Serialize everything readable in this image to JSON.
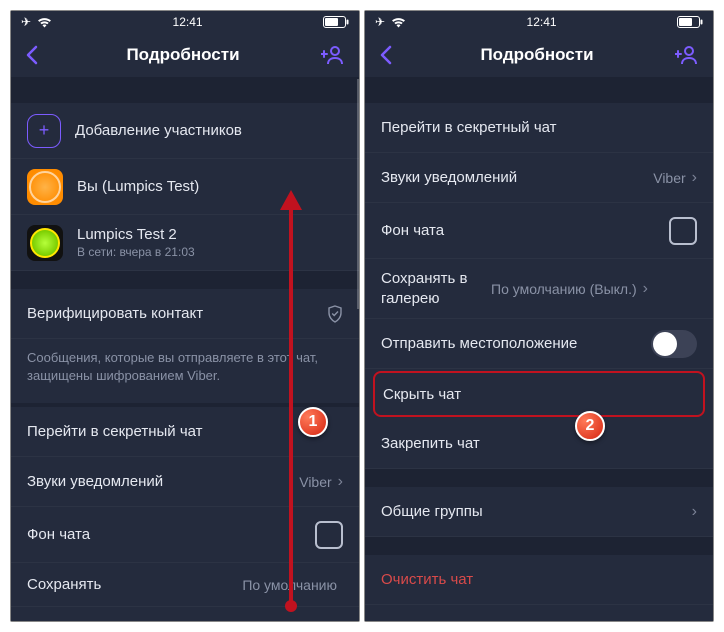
{
  "status": {
    "time": "12:41"
  },
  "nav": {
    "title": "Подробности"
  },
  "left": {
    "add_participants": "Добавление участников",
    "you": "Вы (Lumpics Test)",
    "contact2_name": "Lumpics Test 2",
    "contact2_sub": "В сети: вчера в 21:03",
    "verify": "Верифицировать контакт",
    "note": "Сообщения, которые вы отправляете в этот чат, защищены шифрованием Viber.",
    "secret": "Перейти в секретный чат",
    "sounds": "Звуки уведомлений",
    "sounds_value": "Viber",
    "background": "Фон чата",
    "save_gallery": "Сохранять",
    "save_gallery_value": "По умолчанию"
  },
  "right": {
    "secret": "Перейти в секретный чат",
    "sounds": "Звуки уведомлений",
    "sounds_value": "Viber",
    "background": "Фон чата",
    "save_gallery": "Сохранять в галерею",
    "save_gallery_value": "По умолчанию (Выкл.)",
    "send_location": "Отправить местоположение",
    "hide_chat": "Скрыть чат",
    "pin_chat": "Закрепить чат",
    "groups": "Общие группы",
    "clear": "Очистить чат"
  },
  "badges": {
    "one": "1",
    "two": "2"
  }
}
